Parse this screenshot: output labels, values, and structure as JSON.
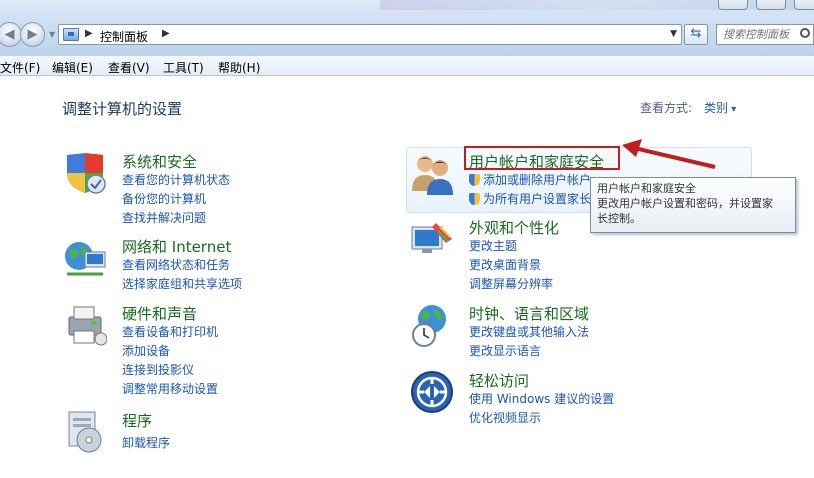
{
  "toolbar": {
    "breadcrumb": "控制面板",
    "search_placeholder": "搜索控制面板"
  },
  "menu": [
    "文件(F)",
    "编辑(E)",
    "查看(V)",
    "工具(T)",
    "帮助(H)"
  ],
  "page": {
    "title": "调整计算机的设置",
    "view_by_label": "查看方式:",
    "view_by_value": "类别"
  },
  "left_categories": [
    {
      "title": "系统和安全",
      "icon": "shield-checkmark-icon",
      "links": [
        "查看您的计算机状态",
        "备份您的计算机",
        "查找并解决问题"
      ]
    },
    {
      "title": "网络和 Internet",
      "icon": "network-globe-icon",
      "links": [
        "查看网络状态和任务",
        "选择家庭组和共享选项"
      ]
    },
    {
      "title": "硬件和声音",
      "icon": "printer-icon",
      "links": [
        "查看设备和打印机",
        "添加设备",
        "连接到投影仪",
        "调整常用移动设置"
      ]
    },
    {
      "title": "程序",
      "icon": "programs-disc-icon",
      "links": [
        "卸载程序"
      ]
    }
  ],
  "right_categories": [
    {
      "title": "用户帐户和家庭安全",
      "icon": "users-icon",
      "links": [
        "添加或删除用户帐户",
        "为所有用户设置家长控制"
      ]
    },
    {
      "title": "外观和个性化",
      "icon": "display-icon",
      "links": [
        "更改主题",
        "更改桌面背景",
        "调整屏幕分辨率"
      ]
    },
    {
      "title": "时钟、语言和区域",
      "icon": "clock-globe-icon",
      "links": [
        "更改键盘或其他输入法",
        "更改显示语言"
      ]
    },
    {
      "title": "轻松访问",
      "icon": "ease-of-access-icon",
      "links": [
        "使用 Windows 建议的设置",
        "优化视频显示"
      ]
    }
  ],
  "tooltip": {
    "title": "用户帐户和家庭安全",
    "line1": "更改用户帐户设置和密码，并设置家",
    "line2": "长控制。"
  },
  "colors": {
    "category_title": "#186b1c",
    "link": "#1a56b3",
    "annotation": "#c11e1e"
  }
}
